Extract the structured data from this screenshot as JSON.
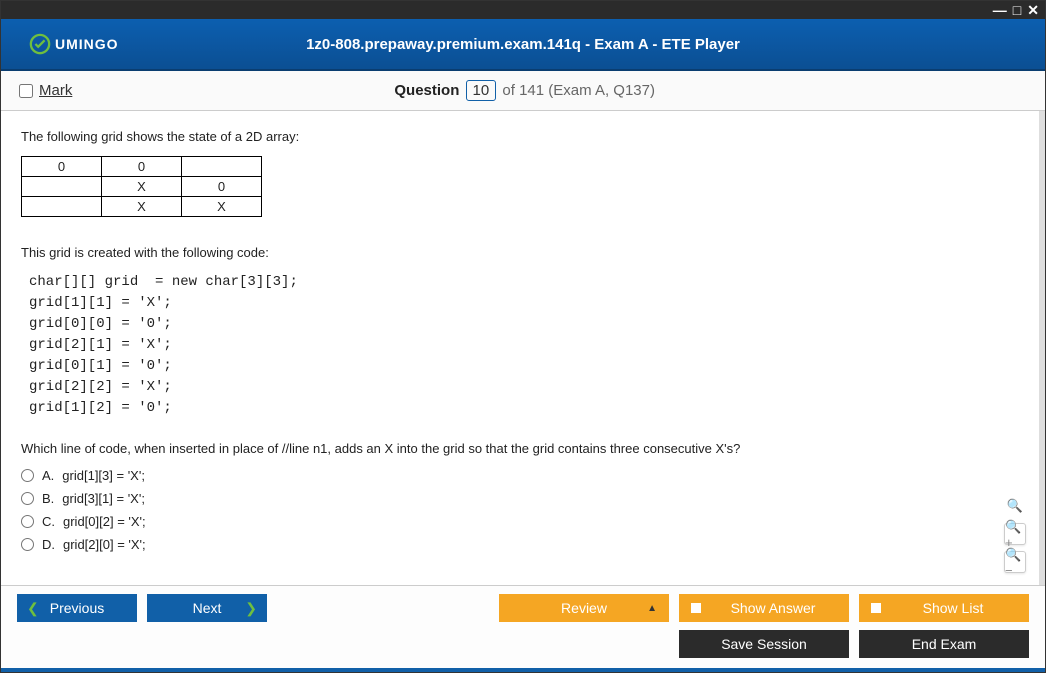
{
  "window_controls": {
    "min": "—",
    "max": "□",
    "close": "✕"
  },
  "logo_text": "UMINGO",
  "header_title": "1z0-808.prepaway.premium.exam.141q - Exam A - ETE Player",
  "mark_label": "Mark",
  "question_label": "Question",
  "question_number": "10",
  "question_total_prefix": "of 141 (Exam A, Q137)",
  "prompt1": "The following grid shows the state of a 2D array:",
  "grid": [
    [
      "0",
      "0",
      ""
    ],
    [
      "",
      "X",
      "0"
    ],
    [
      "",
      "X",
      "X"
    ]
  ],
  "prompt2": "This grid is created with the following code:",
  "code": "char[][] grid  = new char[3][3];\ngrid[1][1] = 'X';\ngrid[0][0] = '0';\ngrid[2][1] = 'X';\ngrid[0][1] = '0';\ngrid[2][2] = 'X';\ngrid[1][2] = '0';",
  "prompt3": "Which line of code, when inserted in place of //line n1, adds an X into the grid so that the grid contains three consecutive X's?",
  "options": [
    {
      "letter": "A.",
      "text": "grid[1][3] = 'X';"
    },
    {
      "letter": "B.",
      "text": "grid[3][1] = 'X';"
    },
    {
      "letter": "C.",
      "text": "grid[0][2] = 'X';"
    },
    {
      "letter": "D.",
      "text": "grid[2][0] = 'X';"
    }
  ],
  "buttons": {
    "previous": "Previous",
    "next": "Next",
    "review": "Review",
    "show_answer": "Show Answer",
    "show_list": "Show List",
    "save_session": "Save Session",
    "end_exam": "End Exam"
  }
}
